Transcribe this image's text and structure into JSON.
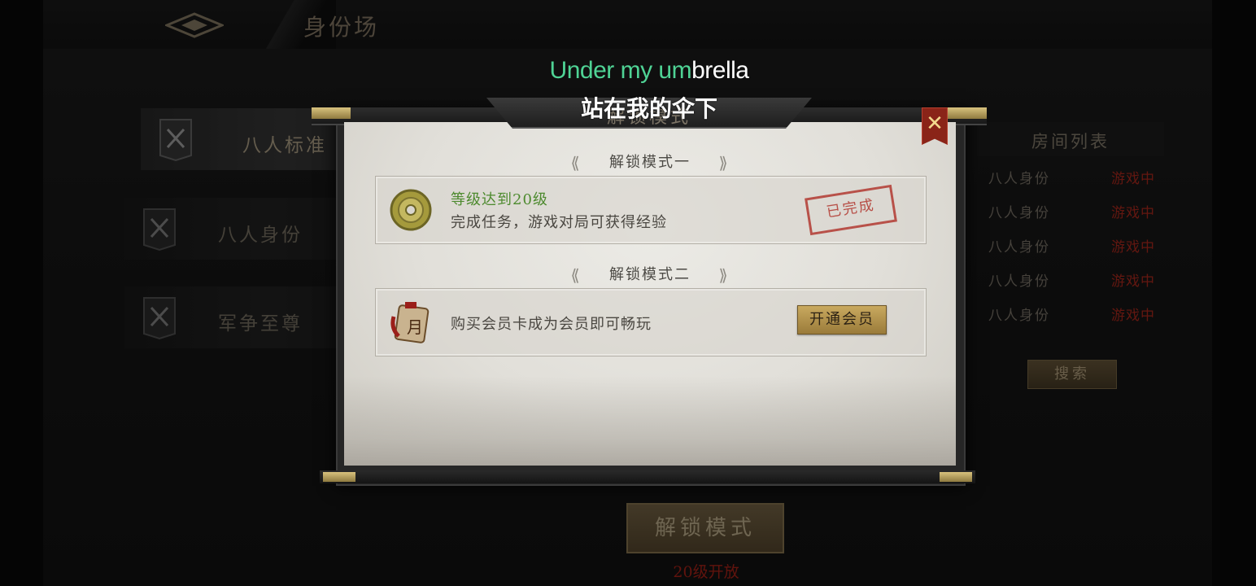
{
  "header": {
    "title": "身份场"
  },
  "menu": {
    "items": [
      {
        "label": "八人标准",
        "active": true
      },
      {
        "label": "八人身份",
        "active": false
      },
      {
        "label": "军争至尊",
        "active": false
      }
    ]
  },
  "room_list": {
    "title": "房间列表",
    "rows": [
      {
        "name": "八人身份",
        "status": "游戏中"
      },
      {
        "name": "八人身份",
        "status": "游戏中"
      },
      {
        "name": "八人身份",
        "status": "游戏中"
      },
      {
        "name": "八人身份",
        "status": "游戏中"
      },
      {
        "name": "八人身份",
        "status": "游戏中"
      }
    ],
    "search_label": "搜索"
  },
  "bottom": {
    "unlock_button": "解锁模式",
    "unlock_hint": "20级开放"
  },
  "dialog": {
    "title": "解锁模式",
    "close_label": "✕",
    "section1": {
      "heading": "解锁模式一",
      "title": "等级达到20级",
      "desc": "完成任务，游戏对局可获得经验",
      "stamp": "已完成"
    },
    "section2": {
      "heading": "解锁模式二",
      "desc": "购买会员卡成为会员即可畅玩",
      "button": "开通会员"
    }
  },
  "subtitles": {
    "en_sung": "Under my um",
    "en_rest": "brella",
    "zh": "站在我的伞下"
  },
  "colors": {
    "accent_gold": "#c9a95f",
    "status_red": "#b52a1e",
    "task_green": "#4d8a2e",
    "karaoke_green": "#4fd395"
  },
  "icons": {
    "menu": "crossed-swords-banner-icon",
    "task": "jade-coin-icon",
    "vip": "vip-card-icon",
    "close": "close-icon",
    "lock": "lock-icon"
  }
}
